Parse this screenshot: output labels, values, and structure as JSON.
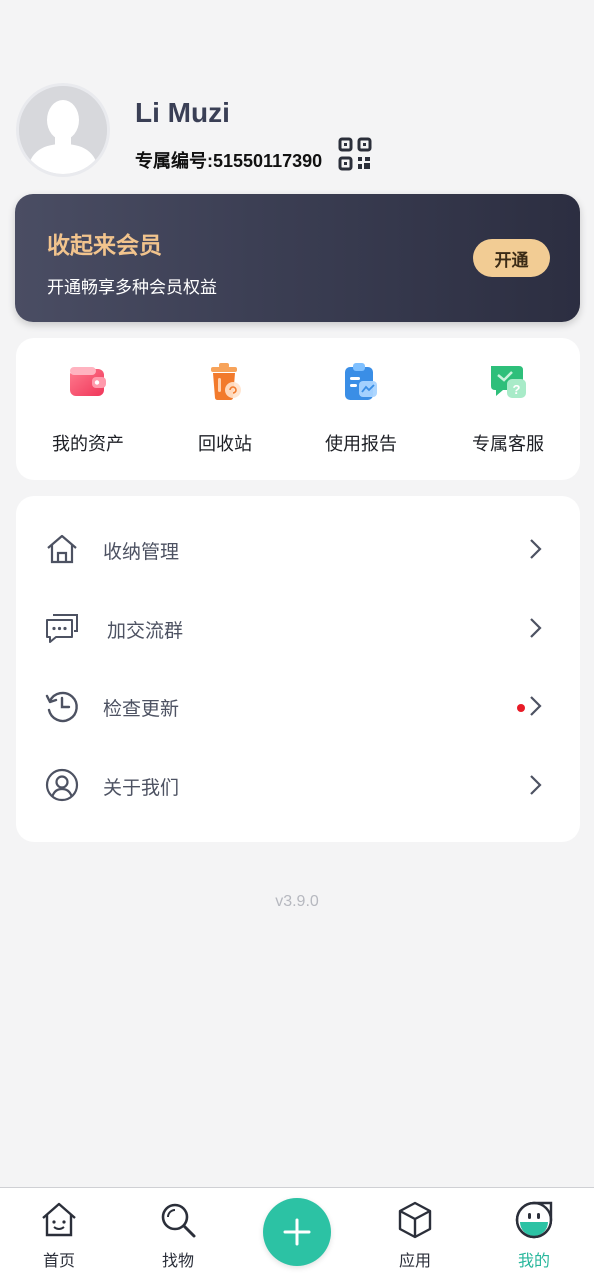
{
  "profile": {
    "name": "Li Muzi",
    "id_text": "专属编号:51550117390"
  },
  "vip": {
    "title": "收起来会员",
    "subtitle": "开通畅享多种会员权益",
    "button": "开通"
  },
  "quick_actions": [
    {
      "label": "我的资产",
      "icon": "wallet-icon"
    },
    {
      "label": "回收站",
      "icon": "recycle-bin-icon"
    },
    {
      "label": "使用报告",
      "icon": "report-clipboard-icon"
    },
    {
      "label": "专属客服",
      "icon": "customer-service-icon"
    }
  ],
  "menu": [
    {
      "label": "收纳管理",
      "icon": "home-icon"
    },
    {
      "label": "加交流群",
      "icon": "chat-bubbles-icon"
    },
    {
      "label": "检查更新",
      "icon": "history-icon",
      "badge": true
    },
    {
      "label": "关于我们",
      "icon": "user-circle-icon"
    }
  ],
  "version": "v3.9.0",
  "tabs": [
    {
      "label": "首页",
      "icon": "home-tab-icon"
    },
    {
      "label": "找物",
      "icon": "search-icon"
    },
    {
      "label": "",
      "icon": "plus-icon"
    },
    {
      "label": "应用",
      "icon": "box-icon"
    },
    {
      "label": "我的",
      "icon": "mascot-icon",
      "active": true
    }
  ],
  "colors": {
    "accent": "#2cc2a4",
    "vip_gold": "#f2c48d",
    "badge_red": "#e81b27"
  }
}
